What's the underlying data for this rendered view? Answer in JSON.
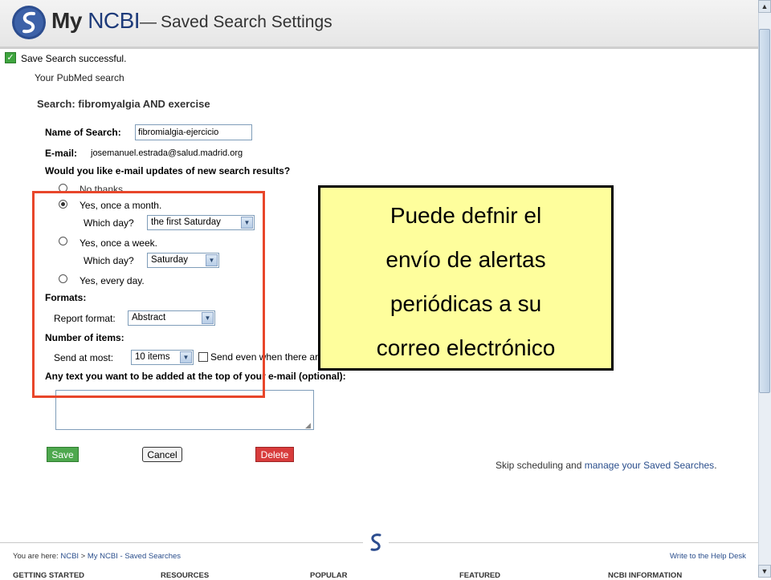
{
  "header": {
    "brand_my": "My",
    "brand_ncbi": "NCBI",
    "separator": "—",
    "title": "Saved Search Settings"
  },
  "status": {
    "message": "Save Search successful."
  },
  "subtitle": "Your PubMed search",
  "search_heading": "Search: fibromyalgia AND exercise",
  "form": {
    "name_label": "Name of Search:",
    "name_value": "fibromialgia-ejercicio",
    "email_label": "E-mail:",
    "email_value": "josemanuel.estrada@salud.madrid.org",
    "updates_question": "Would you like e-mail updates of new search results?",
    "options": {
      "no": "No thanks.",
      "month": "Yes, once a month.",
      "week": "Yes, once a week.",
      "everyday": "Yes, every day."
    },
    "selected_option": "month",
    "which_day_label": "Which day?",
    "month_day": "the first Saturday",
    "week_day": "Saturday",
    "formats_label": "Formats:",
    "report_format_label": "Report format:",
    "report_format": "Abstract",
    "items_label": "Number of items:",
    "send_at_most_label": "Send at most:",
    "items_value": "10 items",
    "send_even_label": "Send even when there ar",
    "free_text_label": "Any text you want to be added at the top of your e-mail (optional):"
  },
  "buttons": {
    "save": "Save",
    "cancel": "Cancel",
    "delete": "Delete"
  },
  "skip": {
    "prefix": "Skip scheduling and ",
    "link": "manage your Saved Searches",
    "suffix": "."
  },
  "callout": {
    "lines": [
      "Puede defnir el",
      "envío de alertas",
      "periódicas a su",
      "correo electrónico"
    ]
  },
  "footer": {
    "breadcrumb_prefix": "You are here: ",
    "breadcrumb_ncbi": "NCBI",
    "breadcrumb_sep": " > ",
    "breadcrumb_myncbi": "My NCBI - Saved Searches",
    "help_link": "Write to the Help Desk",
    "nav": [
      "GETTING STARTED",
      "RESOURCES",
      "POPULAR",
      "FEATURED",
      "NCBI INFORMATION"
    ]
  },
  "colors": {
    "highlight_border": "#e8462a",
    "callout_bg": "#fefe9c",
    "save": "#4ea84e",
    "delete": "#d83c3c",
    "link": "#2a4e8c"
  }
}
